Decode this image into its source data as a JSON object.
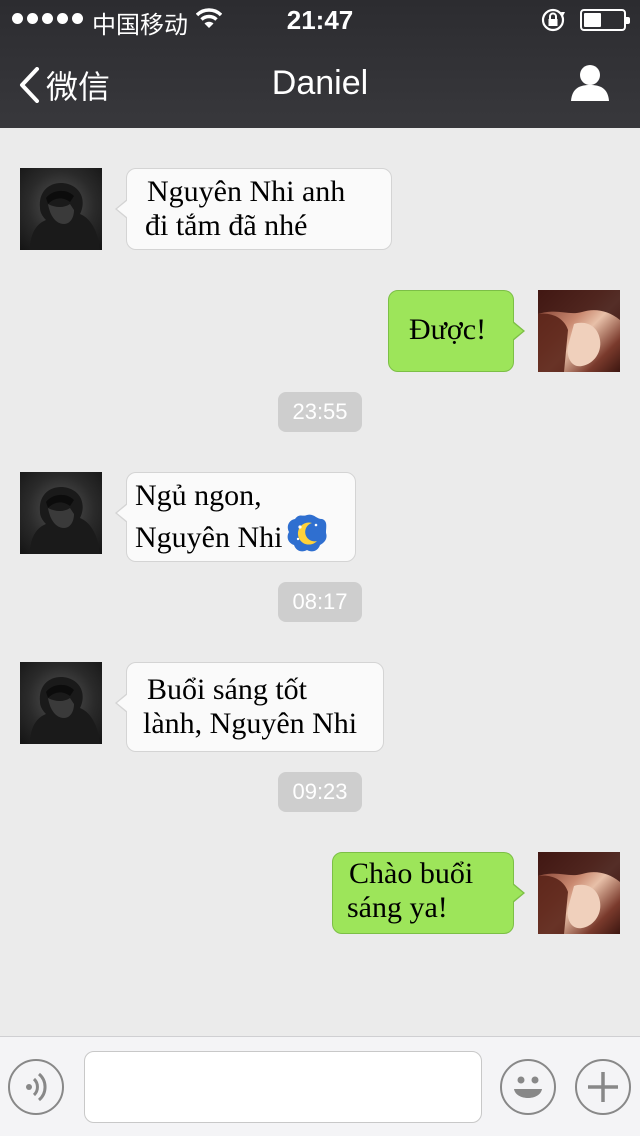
{
  "status_bar": {
    "carrier": "中国移动",
    "time": "21:47",
    "battery_level": 0.45
  },
  "nav": {
    "back_label": "微信",
    "title": "Daniel"
  },
  "messages": [
    {
      "direction": "incoming",
      "lines": [
        "Nguyên Nhi anh",
        "đi tắm đã nhé"
      ]
    },
    {
      "direction": "outgoing",
      "lines": [
        "Được!"
      ]
    },
    {
      "direction": "incoming",
      "lines": [
        "Ngủ ngon,",
        "Nguyên Nhi"
      ],
      "emoji": "sleeping-moon-icon"
    },
    {
      "direction": "incoming",
      "lines": [
        "Buổi sáng tốt",
        "lành, Nguyên Nhi"
      ]
    },
    {
      "direction": "outgoing",
      "lines": [
        "Chào buổi",
        "sáng ya!"
      ]
    }
  ],
  "timestamps": [
    "23:55",
    "08:17",
    "09:23"
  ],
  "input": {
    "placeholder": "",
    "value": ""
  },
  "colors": {
    "nav_bg": "#323236",
    "incoming_bubble": "#fafafa",
    "outgoing_bubble": "#9de55a",
    "chat_bg": "#ebebeb",
    "timestamp_bg": "#cecece"
  }
}
